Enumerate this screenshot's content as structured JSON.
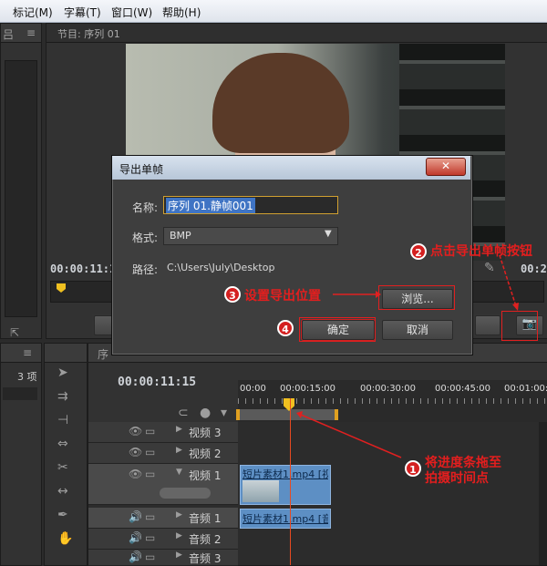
{
  "menu": [
    "标记(M)",
    "字幕(T)",
    "窗口(W)",
    "帮助(H)"
  ],
  "program_monitor": {
    "tab_label": "节目: 序列 01",
    "timecode": "00:00:11:1",
    "timecode_right": "00:2"
  },
  "timeline": {
    "left_panel_count": "3 项",
    "timecode": "00:00:11:15",
    "ruler_ticks": [
      "00:00",
      "00:00:15:00",
      "00:00:30:00",
      "00:00:45:00",
      "00:01:00:0"
    ],
    "tracks": [
      {
        "name": "视频 3",
        "type": "video"
      },
      {
        "name": "视频 2",
        "type": "video"
      },
      {
        "name": "视频 1",
        "type": "video",
        "clip": "短片素材1.mp4 [视"
      },
      {
        "name": "音频 1",
        "type": "audio",
        "clip": "短片素材1.mp4 [音"
      },
      {
        "name": "音频 2",
        "type": "audio"
      },
      {
        "name": "音频 3",
        "type": "audio"
      }
    ]
  },
  "dialog": {
    "title": "导出单帧",
    "name_label": "名称:",
    "name_value": "序列 01.静帧001",
    "format_label": "格式:",
    "format_value": "BMP",
    "path_label": "路径:",
    "path_value": "C:\\Users\\July\\Desktop",
    "browse_label": "浏览...",
    "ok_label": "确定",
    "cancel_label": "取消"
  },
  "annotations": {
    "step1_number": "1",
    "step1_text_line1": "将进度条拖至",
    "step1_text_line2": "拍摄时间点",
    "step2_number": "2",
    "step2_text": "点击导出单帧按钮",
    "step3_number": "3",
    "step3_text": "设置导出位置",
    "step4_number": "4"
  },
  "colors": {
    "annotation_red": "#e41e1e",
    "clip_blue": "#5d8fc4",
    "playhead_yellow": "#f0c020"
  }
}
